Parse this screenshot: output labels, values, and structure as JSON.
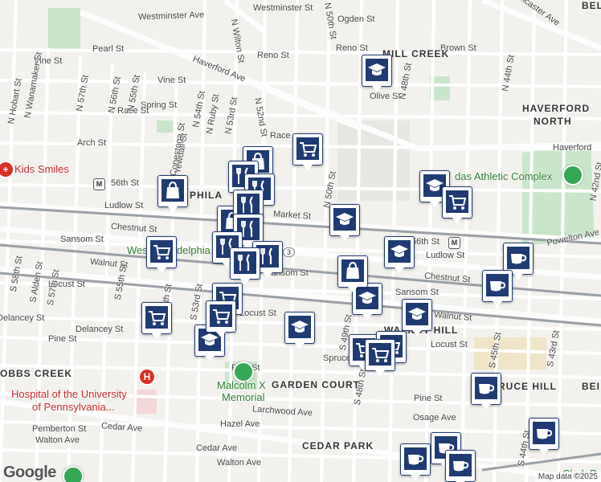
{
  "streets": {
    "westminster_ave": "Westminster Ave",
    "westminster_st": "Westminster St",
    "ogden_st": "Ogden St",
    "lancaster_ave": "Lancaster Ave",
    "pearl_st": "Pearl St",
    "reno_st_1": "Reno St",
    "reno_st_2": "Reno St",
    "brown_st": "Brown St",
    "vine_st_1": "Vine St",
    "vine_st_2": "Vine St",
    "haverford_ave_1": "Haverford Ave",
    "haverford_ave_2": "Haverford",
    "olive_st": "Olive St",
    "spring_st": "Spring St",
    "race_st_1": "Race St",
    "race_st_2": "Race",
    "arch_st": "Arch St",
    "n_hobart_st": "N Hobart St",
    "n_wanamaker_st": "N Wanamaker St",
    "n_57th_st": "N 57th St",
    "n_56th_st": "N 56th St",
    "n_55th_st": "N 55th St",
    "n_54th_st": "N 54th St",
    "n_ruby_st": "N Ruby St",
    "n_53rd_st": "N 53rd St",
    "n_52nd_st": "N 52nd St",
    "n_wilton_st": "N Wilton St",
    "n_50th_st_1": "N 50th St",
    "n_50th_st_2": "N 50th St",
    "n_48th_st": "N 48th St",
    "n_44th_st": "N 44th St",
    "n_42nd_st": "N 42nd St",
    "conestoga_st": "Conestoga St",
    "yewdall_st": "Yewdall St",
    "56th_st_1": "56th St",
    "56th_st_2": "56th St",
    "ludlow_st_1": "Ludlow St",
    "ludlow_st_2": "Ludlow St",
    "market_st": "Market St",
    "chestnut_st_1": "Chestnut St",
    "chestnut_st_2": "Chestnut St",
    "sansom_st_1": "Sansom St",
    "sansom_st_2": "Sansom St",
    "sansom_st_3": "Sansom St",
    "walnut_st_1": "Walnut St",
    "walnut_st_2": "Walnut St",
    "locust_st_1": "Locust St",
    "locust_st_2": "Locust St",
    "locust_st_3": "Locust St",
    "delancey_st_1": "Delancey St",
    "delancey_st_2": "Delancey St",
    "pine_st_1": "Pine St",
    "pine_st_2": "Pine St",
    "pine_st_3": "Pine St",
    "spruce_st": "Spruce St",
    "s_58th_st": "S 58th St",
    "s_alden_st": "S Alden St",
    "s_57th_st": "S 57th St",
    "s_55th_st": "S 55th St",
    "s_54th_st": "S 54th St",
    "s_53rd_st": "S 53rd St",
    "s_49th_st": "S 49th St",
    "s_48th_st": "S 48th St",
    "s_45th_st": "S 45th St",
    "s_44th_st": "S 44th St",
    "s_43rd_st": "S 43rd St",
    "larchwood_ave": "Larchwood Ave",
    "hazel_ave": "Hazel Ave",
    "cedar_ave_1": "Cedar Ave",
    "cedar_ave_2": "Cedar Ave",
    "pemberton_st": "Pemberton St",
    "walton_ave_1": "Walton Ave",
    "walton_ave_2": "Walton Ave",
    "osage_ave": "Osage Ave",
    "powelton_ave": "Powelton Ave",
    "route_3": "3"
  },
  "areas": {
    "mill_creek": "MILL CREEK",
    "haverford": "HAVERFORD",
    "north": "NORTH",
    "philadelphia": "PHILA",
    "west_philadelphia": "West Philadelphia",
    "walnut_hill": "WALNUT HILL",
    "cobbs_creek": "OBBS CREEK",
    "garden_court": "GARDEN COURT",
    "cedar_park": "CEDAR PARK",
    "spruce_hill": "RUCE HILL",
    "bei_1": "BEI",
    "bei_2": "BEL"
  },
  "pois": {
    "kids_smiles": "Kids Smiles",
    "hospital_line1": "Hospital of the University",
    "hospital_line2": "of Pennsylvania...",
    "malcolm_line1": "Malcolm X",
    "malcolm_line2": "Memorial",
    "athletic_complex": "das Athletic Complex",
    "clark_park": "Clark P"
  },
  "metro": {
    "symbol": "M"
  },
  "branding": {
    "logo": "Google",
    "attribution": "Map data ©2025"
  },
  "colors": {
    "marker": "#1f3b73",
    "park": "#c8e6c9",
    "rail": "#9aa0a6",
    "road": "#ffffff"
  }
}
